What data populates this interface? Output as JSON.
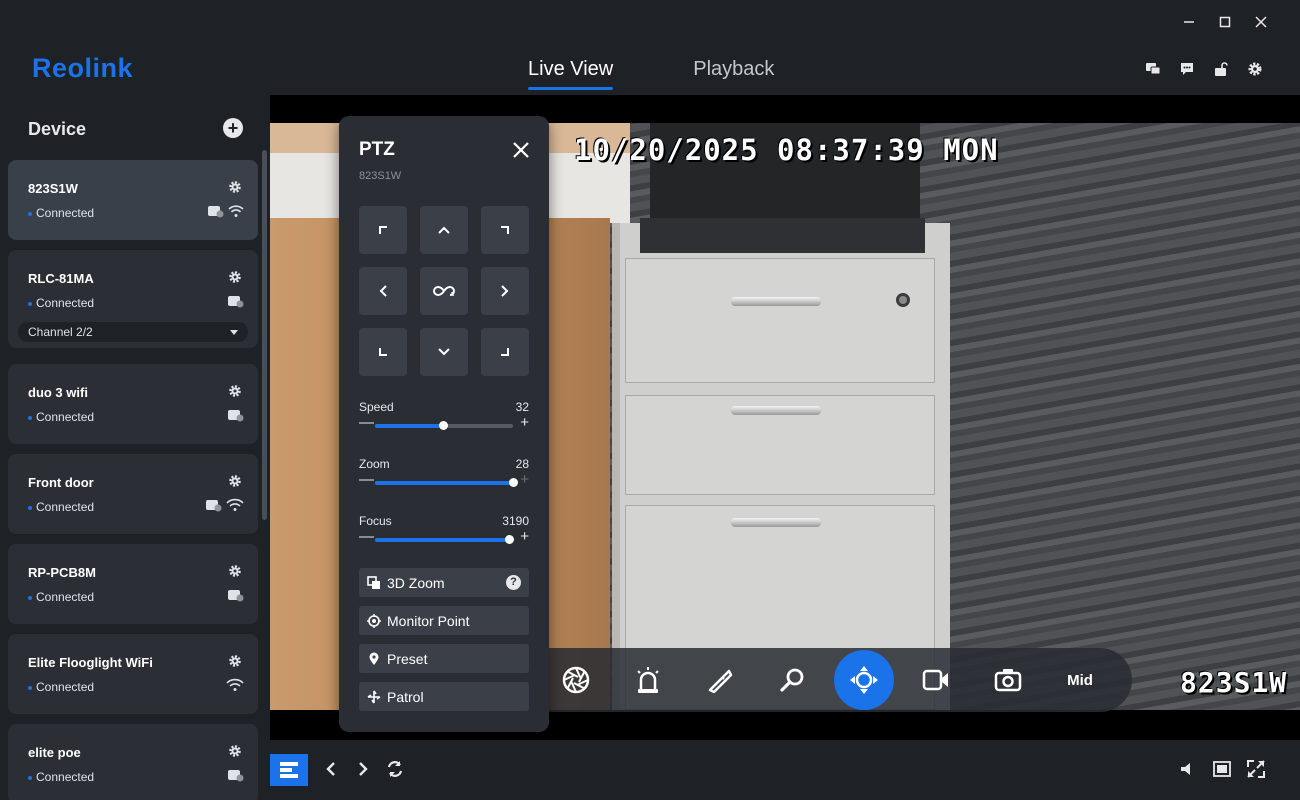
{
  "app": {
    "brand": "Reolink",
    "brand_color": "#1a73e8"
  },
  "header": {
    "tabs": [
      {
        "label": "Live View",
        "active": true
      },
      {
        "label": "Playback",
        "active": false
      }
    ],
    "icons": [
      "feedback-icon",
      "message-icon",
      "unlock-icon",
      "settings-icon"
    ],
    "window_controls": [
      "minimize-icon",
      "maximize-icon",
      "close-icon"
    ]
  },
  "sidebar": {
    "title": "Device",
    "devices": [
      {
        "name": "823S1W",
        "status": "Connected",
        "selected": true,
        "icons": [
          "storage-icon",
          "wifi-icon"
        ]
      },
      {
        "name": "RLC-81MA",
        "status": "Connected",
        "channel": "Channel 2/2",
        "icons": [
          "storage-icon"
        ]
      },
      {
        "name": "duo 3 wifi",
        "status": "Connected",
        "icons": [
          "storage-icon"
        ]
      },
      {
        "name": "Front door",
        "status": "Connected",
        "icons": [
          "storage-icon",
          "wifi-icon"
        ]
      },
      {
        "name": "RP-PCB8M",
        "status": "Connected",
        "icons": [
          "storage-icon"
        ]
      },
      {
        "name": "Elite Flooglight WiFi",
        "status": "Connected",
        "icons": [
          "wifi-icon"
        ]
      },
      {
        "name": "elite poe",
        "status": "Connected",
        "icons": [
          "storage-icon"
        ]
      }
    ]
  },
  "video": {
    "osd_timestamp": "10/20/2025 08:37:39 MON",
    "osd_camera_name": "823S1W"
  },
  "ptz": {
    "title": "PTZ",
    "device": "823S1W",
    "sliders": [
      {
        "label": "Speed",
        "value": "32",
        "fraction": 0.49
      },
      {
        "label": "Zoom",
        "value": "28",
        "fraction": 1.0
      },
      {
        "label": "Focus",
        "value": "3190",
        "fraction": 0.97
      }
    ],
    "options": [
      {
        "label": "3D Zoom",
        "icon": "3d-zoom-icon",
        "help": "?"
      },
      {
        "label": "Monitor Point",
        "icon": "monitor-point-icon"
      },
      {
        "label": "Preset",
        "icon": "location-pin-icon"
      },
      {
        "label": "Patrol",
        "icon": "patrol-icon"
      }
    ]
  },
  "control_bar": {
    "buttons": [
      "aperture-icon",
      "siren-icon",
      "spotlight-icon",
      "zoom-icon",
      "ptz-icon",
      "record-icon",
      "snapshot-icon"
    ],
    "active": "ptz-icon",
    "quality_label": "Mid"
  },
  "bottom_toolbar": {
    "left": [
      "layout-icon",
      "prev-icon",
      "next-icon",
      "refresh-icon"
    ],
    "right": [
      "volume-icon",
      "fullwindow-icon",
      "fullscreen-icon"
    ]
  }
}
